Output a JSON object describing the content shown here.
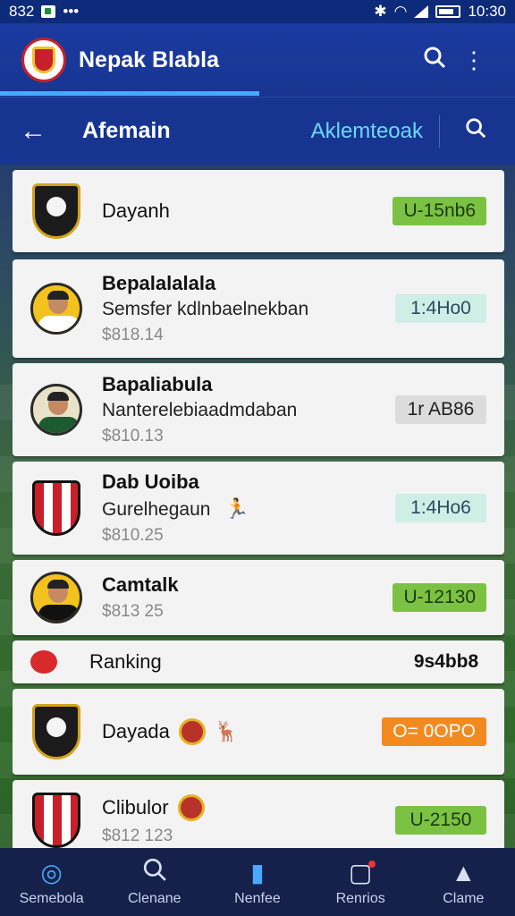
{
  "status_bar": {
    "left_text": "832",
    "time": "10:30"
  },
  "app_bar": {
    "title": "Nepak Blabla"
  },
  "sub_bar": {
    "title": "Afemain",
    "link": "Aklemteoak"
  },
  "rows": [
    {
      "name": "Dayanh",
      "desc": "",
      "price": "",
      "badge": "U-15nb6"
    },
    {
      "name": "Bepalalalala",
      "desc": "Semsfer kdlnbaelnekban",
      "price": "$818.14",
      "badge": "1:4Ho0"
    },
    {
      "name": "Bapaliabula",
      "desc": "Nanterelebiaadmdaban",
      "price": "$810.13",
      "badge": "1r AB86"
    },
    {
      "name": "Dab Uoiba",
      "desc": "Gurelhegaun",
      "price": "$810.25",
      "badge": "1:4Ho6"
    },
    {
      "name": "Camtalk",
      "desc": "",
      "price": "$813 25",
      "badge": "U-12130"
    },
    {
      "name": "Ranking",
      "desc": "",
      "price": "",
      "badge": "9s4bb8"
    },
    {
      "name": "Dayada",
      "desc": "",
      "price": "",
      "badge": "O= 0OPO"
    },
    {
      "name": "Clibulor",
      "desc": "",
      "price": "$812 123",
      "badge": "U-2150"
    }
  ],
  "bottom_nav": [
    {
      "label": "Semebola",
      "icon": "football-icon"
    },
    {
      "label": "Clenane",
      "icon": "search-icon"
    },
    {
      "label": "Nenfee",
      "icon": "bookmark-icon"
    },
    {
      "label": "Renrios",
      "icon": "inbox-icon"
    },
    {
      "label": "Clame",
      "icon": "trophy-icon"
    }
  ],
  "colors": {
    "app_bar": "#1b3aa0",
    "accent": "#4aa8ff",
    "badge_green": "#7cc242",
    "badge_orange": "#f38a1f"
  }
}
